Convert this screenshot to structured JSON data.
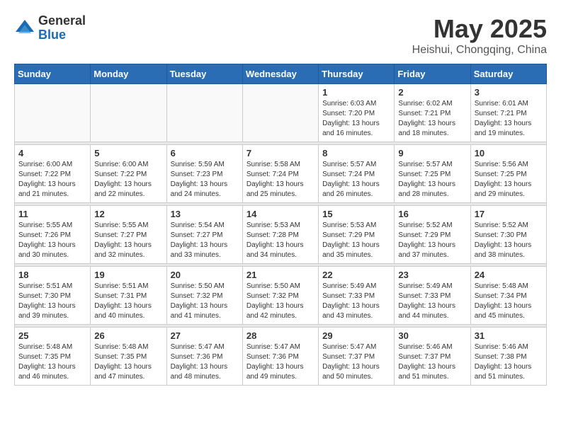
{
  "logo": {
    "general": "General",
    "blue": "Blue"
  },
  "title": "May 2025",
  "location": "Heishui, Chongqing, China",
  "days_of_week": [
    "Sunday",
    "Monday",
    "Tuesday",
    "Wednesday",
    "Thursday",
    "Friday",
    "Saturday"
  ],
  "weeks": [
    [
      {
        "day": "",
        "info": ""
      },
      {
        "day": "",
        "info": ""
      },
      {
        "day": "",
        "info": ""
      },
      {
        "day": "",
        "info": ""
      },
      {
        "day": "1",
        "info": "Sunrise: 6:03 AM\nSunset: 7:20 PM\nDaylight: 13 hours\nand 16 minutes."
      },
      {
        "day": "2",
        "info": "Sunrise: 6:02 AM\nSunset: 7:21 PM\nDaylight: 13 hours\nand 18 minutes."
      },
      {
        "day": "3",
        "info": "Sunrise: 6:01 AM\nSunset: 7:21 PM\nDaylight: 13 hours\nand 19 minutes."
      }
    ],
    [
      {
        "day": "4",
        "info": "Sunrise: 6:00 AM\nSunset: 7:22 PM\nDaylight: 13 hours\nand 21 minutes."
      },
      {
        "day": "5",
        "info": "Sunrise: 6:00 AM\nSunset: 7:22 PM\nDaylight: 13 hours\nand 22 minutes."
      },
      {
        "day": "6",
        "info": "Sunrise: 5:59 AM\nSunset: 7:23 PM\nDaylight: 13 hours\nand 24 minutes."
      },
      {
        "day": "7",
        "info": "Sunrise: 5:58 AM\nSunset: 7:24 PM\nDaylight: 13 hours\nand 25 minutes."
      },
      {
        "day": "8",
        "info": "Sunrise: 5:57 AM\nSunset: 7:24 PM\nDaylight: 13 hours\nand 26 minutes."
      },
      {
        "day": "9",
        "info": "Sunrise: 5:57 AM\nSunset: 7:25 PM\nDaylight: 13 hours\nand 28 minutes."
      },
      {
        "day": "10",
        "info": "Sunrise: 5:56 AM\nSunset: 7:25 PM\nDaylight: 13 hours\nand 29 minutes."
      }
    ],
    [
      {
        "day": "11",
        "info": "Sunrise: 5:55 AM\nSunset: 7:26 PM\nDaylight: 13 hours\nand 30 minutes."
      },
      {
        "day": "12",
        "info": "Sunrise: 5:55 AM\nSunset: 7:27 PM\nDaylight: 13 hours\nand 32 minutes."
      },
      {
        "day": "13",
        "info": "Sunrise: 5:54 AM\nSunset: 7:27 PM\nDaylight: 13 hours\nand 33 minutes."
      },
      {
        "day": "14",
        "info": "Sunrise: 5:53 AM\nSunset: 7:28 PM\nDaylight: 13 hours\nand 34 minutes."
      },
      {
        "day": "15",
        "info": "Sunrise: 5:53 AM\nSunset: 7:29 PM\nDaylight: 13 hours\nand 35 minutes."
      },
      {
        "day": "16",
        "info": "Sunrise: 5:52 AM\nSunset: 7:29 PM\nDaylight: 13 hours\nand 37 minutes."
      },
      {
        "day": "17",
        "info": "Sunrise: 5:52 AM\nSunset: 7:30 PM\nDaylight: 13 hours\nand 38 minutes."
      }
    ],
    [
      {
        "day": "18",
        "info": "Sunrise: 5:51 AM\nSunset: 7:30 PM\nDaylight: 13 hours\nand 39 minutes."
      },
      {
        "day": "19",
        "info": "Sunrise: 5:51 AM\nSunset: 7:31 PM\nDaylight: 13 hours\nand 40 minutes."
      },
      {
        "day": "20",
        "info": "Sunrise: 5:50 AM\nSunset: 7:32 PM\nDaylight: 13 hours\nand 41 minutes."
      },
      {
        "day": "21",
        "info": "Sunrise: 5:50 AM\nSunset: 7:32 PM\nDaylight: 13 hours\nand 42 minutes."
      },
      {
        "day": "22",
        "info": "Sunrise: 5:49 AM\nSunset: 7:33 PM\nDaylight: 13 hours\nand 43 minutes."
      },
      {
        "day": "23",
        "info": "Sunrise: 5:49 AM\nSunset: 7:33 PM\nDaylight: 13 hours\nand 44 minutes."
      },
      {
        "day": "24",
        "info": "Sunrise: 5:48 AM\nSunset: 7:34 PM\nDaylight: 13 hours\nand 45 minutes."
      }
    ],
    [
      {
        "day": "25",
        "info": "Sunrise: 5:48 AM\nSunset: 7:35 PM\nDaylight: 13 hours\nand 46 minutes."
      },
      {
        "day": "26",
        "info": "Sunrise: 5:48 AM\nSunset: 7:35 PM\nDaylight: 13 hours\nand 47 minutes."
      },
      {
        "day": "27",
        "info": "Sunrise: 5:47 AM\nSunset: 7:36 PM\nDaylight: 13 hours\nand 48 minutes."
      },
      {
        "day": "28",
        "info": "Sunrise: 5:47 AM\nSunset: 7:36 PM\nDaylight: 13 hours\nand 49 minutes."
      },
      {
        "day": "29",
        "info": "Sunrise: 5:47 AM\nSunset: 7:37 PM\nDaylight: 13 hours\nand 50 minutes."
      },
      {
        "day": "30",
        "info": "Sunrise: 5:46 AM\nSunset: 7:37 PM\nDaylight: 13 hours\nand 51 minutes."
      },
      {
        "day": "31",
        "info": "Sunrise: 5:46 AM\nSunset: 7:38 PM\nDaylight: 13 hours\nand 51 minutes."
      }
    ]
  ]
}
